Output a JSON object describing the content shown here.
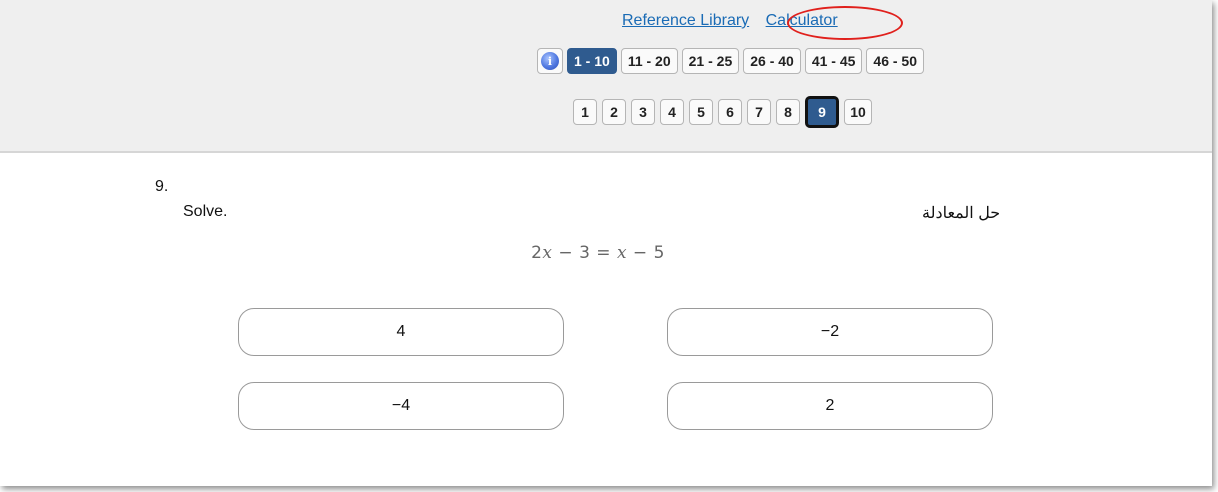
{
  "header": {
    "reference_library": "Reference Library",
    "calculator": "Calculator",
    "info_glyph": "i",
    "ranges": [
      "1 - 10",
      "11 - 20",
      "21 - 25",
      "26 - 40",
      "41 - 45",
      "46 - 50"
    ],
    "active_range": "1 - 10",
    "questions": [
      "1",
      "2",
      "3",
      "4",
      "5",
      "6",
      "7",
      "8",
      "9",
      "10"
    ],
    "active_question": "9",
    "colors": {
      "active_bg": "#2f5b8f",
      "link": "#1a6bb5",
      "annotation_circle": "#e0201c"
    }
  },
  "question": {
    "number": "9.",
    "prompt_en": "Solve.",
    "prompt_ar": "حل المعادلة",
    "equation": {
      "lhs_coef": "2",
      "var": "x",
      "lhs_rest": " − 3 = ",
      "rhs_var": "x",
      "rhs_rest": " − 5"
    }
  },
  "answers": [
    "4",
    "−2",
    "−4",
    "2"
  ]
}
